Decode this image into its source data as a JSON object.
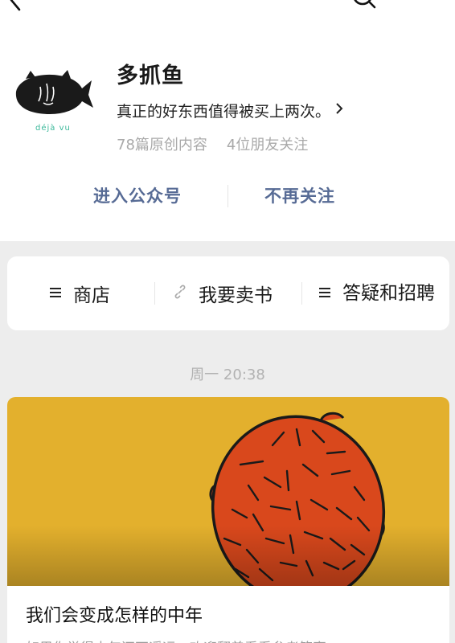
{
  "account": {
    "name": "多抓鱼",
    "description": "真正的好东西值得被买上两次。",
    "stats": {
      "articles": "78篇原创内容",
      "friends": "4位朋友关注"
    },
    "avatar_text": "déjà vu"
  },
  "actions": {
    "enter": "进入公众号",
    "unfollow": "不再关注"
  },
  "menu": [
    {
      "label": "商店",
      "icon": "menu-lines-icon"
    },
    {
      "label": "我要卖书",
      "icon": "link-icon"
    },
    {
      "label": "答疑和招聘",
      "icon": "menu-lines-icon"
    }
  ],
  "timestamp": "周一 20:38",
  "article": {
    "title": "我们会变成怎样的中年",
    "digest": "如果你觉得中年还不遥远，欢迎翻着看看参考答案"
  },
  "colors": {
    "link_blue": "#576b95",
    "cover_yellow": "#e3b02d",
    "face_orange": "#d9481c",
    "avatar_text_green": "#3bb89a"
  }
}
